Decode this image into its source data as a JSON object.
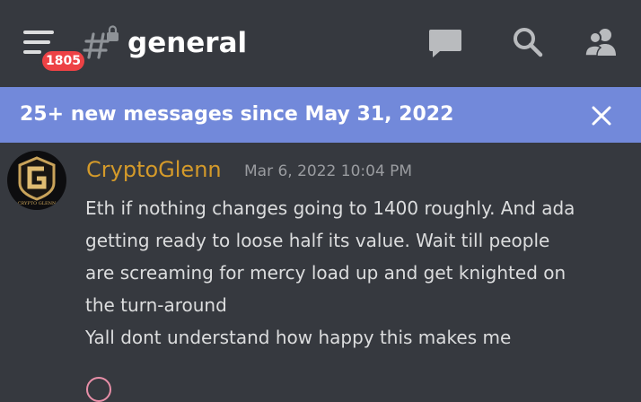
{
  "header": {
    "menu_icon": "hamburger-menu-icon",
    "unread_badge": "1805",
    "channel_icon": "locked-hash-channel-icon",
    "channel_name": "general",
    "actions": [
      {
        "icon": "threads-chat-bubble-icon"
      },
      {
        "icon": "search-icon"
      },
      {
        "icon": "members-icon"
      }
    ]
  },
  "banner": {
    "text": "25+ new messages since May 31, 2022",
    "close_icon": "close-icon",
    "color": "#7289da"
  },
  "message": {
    "avatar_icon": "cryptoglenn-logo-avatar",
    "avatar_text": "CRYPTO GLENN",
    "username": "CryptoGlenn",
    "username_color": "#d49a2a",
    "timestamp": "Mar 6, 2022 10:04 PM",
    "lines": [
      "Eth if nothing changes going to 1400 roughly. And ada",
      "getting ready to loose half its value. Wait till people",
      "are screaming for mercy load up and get knighted  on",
      "the turn-around",
      "Yall dont understand how happy this makes me"
    ]
  },
  "colors": {
    "background": "#36393f",
    "text": "#dcddde",
    "badge": "#ed4245"
  }
}
